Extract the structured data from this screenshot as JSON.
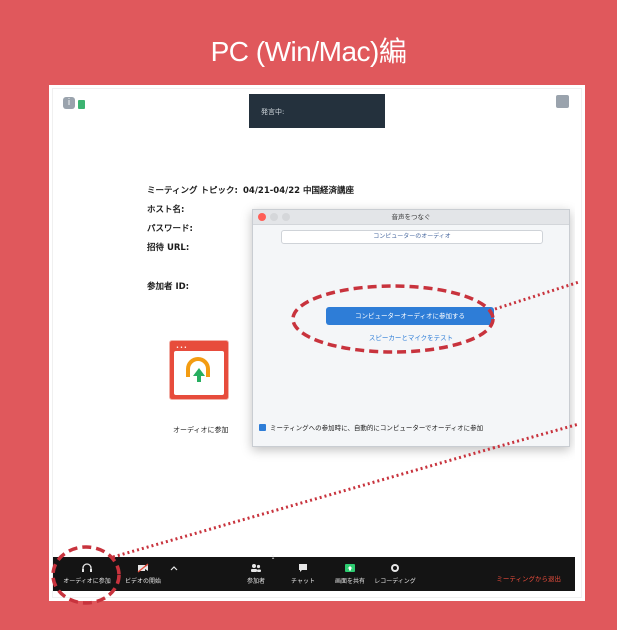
{
  "header": {
    "title": "PC (Win/Mac)編"
  },
  "talking_indicator": "発言中:",
  "meeting_info": {
    "topic_label": "ミーティング トピック:",
    "topic_value": "04/21-04/22 中国経済講座",
    "host_label": "ホスト名:",
    "password_label": "パスワード:",
    "invite_url_label": "招待 URL:",
    "participant_id_label": "参加者 ID:"
  },
  "join_audio_card_label": "オーディオに参加",
  "dialog": {
    "title": "音声をつなぐ",
    "tab_label": "コンピューターのオーディオ",
    "join_button": "コンピューターオーディオに参加する",
    "test_link": "スピーカーとマイクをテスト",
    "auto_join_checkbox": "ミーティングへの参加時に、自動的にコンピューターでオーディオに参加"
  },
  "toolbar": {
    "join_audio": "オーディオに参加",
    "start_video": "ビデオの開始",
    "participants": "参加者",
    "participants_count": "1",
    "chat": "チャット",
    "share_screen": "画面を共有",
    "recording": "レコーディング",
    "leave_meeting": "ミーティングから退出"
  },
  "colors": {
    "background": "#e0585c",
    "toolbar": "#141414",
    "accent": "#2e7dd7",
    "highlight": "#c8333d"
  },
  "icons": [
    "info-icon",
    "lock-icon",
    "fullscreen-icon",
    "headphones-icon",
    "video-off-icon",
    "chevron-up-icon",
    "participants-icon",
    "chat-icon",
    "share-screen-icon",
    "record-icon"
  ]
}
